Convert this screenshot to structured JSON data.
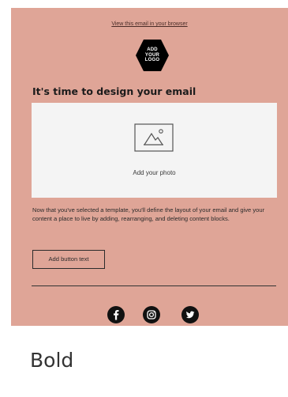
{
  "preview": {
    "view_in_browser": "View this email in your browser",
    "logo": {
      "line1": "ADD",
      "line2": "YOUR",
      "line3": "LOGO"
    },
    "headline": "It's time to design your email",
    "photo": {
      "label": "Add your photo",
      "icon": "image-icon"
    },
    "body": "Now that you've selected a template, you'll define the layout of your email and give your content a place to live by adding, rearranging, and deleting content blocks.",
    "button_label": "Add button text",
    "social_icons": [
      "facebook-icon",
      "instagram-icon",
      "twitter-icon"
    ]
  },
  "template": {
    "name": "Bold"
  },
  "colors": {
    "preview_background": "#dfa597",
    "photo_background": "#f4f4f4",
    "dark": "#111111"
  }
}
